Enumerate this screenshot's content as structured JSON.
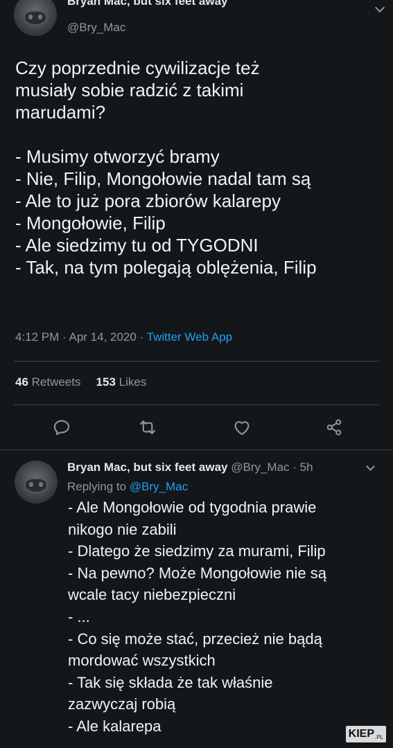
{
  "tweet": {
    "author_name": "Bryan Mac, but six feet away",
    "author_handle": "@Bry_Mac",
    "lines": [
      "Czy poprzednie cywilizacje też",
      "musiały sobie radzić z takimi",
      "marudami?",
      "",
      "- Musimy otworzyć bramy",
      "- Nie, Filip, Mongołowie nadal tam są",
      "- Ale to już pora zbiorów kalarepy",
      "- Mongołowie, Filip",
      "- Ale siedzimy tu od TYGODNI",
      "- Tak, na tym polegają oblężenia, Filip"
    ],
    "timestamp": "4:12 PM · Apr 14, 2020 · ",
    "source_app": "Twitter Web App",
    "retweets_count": "46",
    "retweets_label": "Retweets",
    "likes_count": "153",
    "likes_label": "Likes",
    "actions": [
      "reply-icon",
      "retweet-icon",
      "like-icon",
      "share-icon"
    ]
  },
  "reply": {
    "author_name": "Bryan Mac, but six feet away",
    "author_handle_time": " @Bry_Mac · 5h",
    "replying_prefix": "Replying to ",
    "replying_mention": "@Bry_Mac",
    "lines": [
      "- Ale Mongołowie od tygodnia prawie",
      "nikogo nie zabili",
      "- Dlatego że siedzimy za murami, Filip",
      "- Na pewno? Może Mongołowie nie są",
      "wcale tacy niebezpieczni",
      "- ...",
      "- Co się może stać, przecież nie bądą",
      "mordować wszystkich",
      "- Tak się składa że tak właśnie",
      "zazwyczaj robią",
      "- Ale kalarepa"
    ]
  },
  "watermark": {
    "brand": "KIEP",
    "suffix": ".PL"
  },
  "colors": {
    "background": "#14171a",
    "accent": "#1da1f2",
    "muted": "#8899a6",
    "divider": "#38444d"
  }
}
